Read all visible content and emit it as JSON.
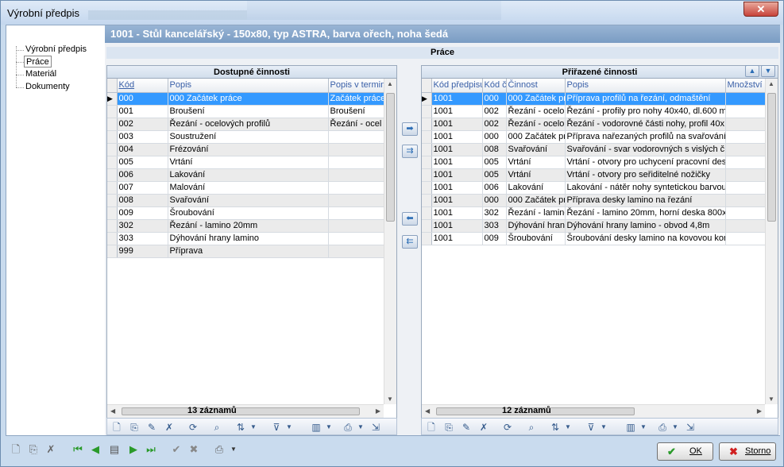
{
  "window": {
    "title": "Výrobní předpis",
    "close_icon": "close-icon"
  },
  "tree": {
    "items": [
      "Výrobní předpis",
      "Práce",
      "Materiál",
      "Dokumenty"
    ],
    "selected": "Práce"
  },
  "header": {
    "title": "1001  -  Stůl kancelářský - 150x80, typ ASTRA, barva ořech, noha šedá"
  },
  "section_title": "Práce",
  "available": {
    "title": "Dostupné činnosti",
    "columns": [
      "Kód",
      "Popis",
      "Popis v termin"
    ],
    "rows": [
      [
        "000",
        "000 Začátek práce",
        "Začátek práce"
      ],
      [
        "001",
        "Broušení",
        "Broušení"
      ],
      [
        "002",
        "Řezání - ocelových profilů",
        "Řezání - ocel"
      ],
      [
        "003",
        "Soustružení",
        ""
      ],
      [
        "004",
        "Frézování",
        ""
      ],
      [
        "005",
        "Vrtání",
        ""
      ],
      [
        "006",
        "Lakování",
        ""
      ],
      [
        "007",
        "Malování",
        ""
      ],
      [
        "008",
        "Svařování",
        ""
      ],
      [
        "009",
        "Šroubování",
        ""
      ],
      [
        "302",
        "Řezání - lamino 20mm",
        ""
      ],
      [
        "303",
        "Dýhování hrany lamino",
        ""
      ],
      [
        "999",
        "Příprava",
        ""
      ]
    ],
    "count": "13 záznamů"
  },
  "assigned": {
    "title": "Přiřazené činnosti",
    "columns": [
      "Kód předpisu",
      "Kód č",
      "Činnost",
      "Popis",
      "Množství"
    ],
    "rows": [
      [
        "1001",
        "000",
        "000 Začátek pr",
        "Příprava profilů na řezání, odmaštění"
      ],
      [
        "1001",
        "002",
        "Řezání - ocelo",
        "Řezání - profily pro nohy 40x40, dl.600  m"
      ],
      [
        "1001",
        "002",
        "Řezání - ocelo",
        "Řezání - vodorovné části nohy, profil 40x"
      ],
      [
        "1001",
        "000",
        "000 Začátek pr",
        "Příprava nařezaných profilů na svařování"
      ],
      [
        "1001",
        "008",
        "Svařování",
        "Svařování - svar vodorovných s vislých č"
      ],
      [
        "1001",
        "005",
        "Vrtání",
        "Vrtání - otvory pro uchycení pracovní des"
      ],
      [
        "1001",
        "005",
        "Vrtání",
        "Vrtání - otvory pro seřiditelné nožičky"
      ],
      [
        "1001",
        "006",
        "Lakování",
        "Lakování - nátěr nohy syntetickou barvou"
      ],
      [
        "1001",
        "000",
        "000 Začátek pr",
        "Příprava desky lamino na řezání"
      ],
      [
        "1001",
        "302",
        "Řezání - lamino",
        "Řezání - lamino 20mm, horní deska 800x1"
      ],
      [
        "1001",
        "303",
        "Dýhování hran",
        "Dýhování hrany lamino - obvod 4,8m"
      ],
      [
        "1001",
        "009",
        "Šroubování",
        "Šroubování desky lamino na kovovou kons"
      ]
    ],
    "count": "12 záznamů"
  },
  "buttons": {
    "ok": "OK",
    "cancel": "Storno"
  }
}
